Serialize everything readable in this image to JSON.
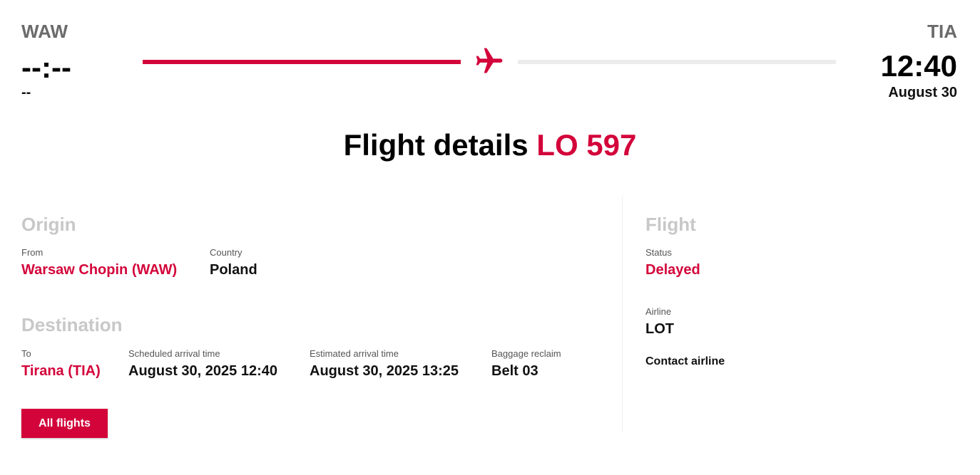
{
  "route": {
    "origin_code": "WAW",
    "destination_code": "TIA",
    "departure_time": "--:--",
    "departure_date": "--",
    "arrival_time": "12:40",
    "arrival_date": "August 30",
    "progress": 0.5
  },
  "title": {
    "prefix": "Flight details",
    "flight_number": "LO 597"
  },
  "origin": {
    "heading": "Origin",
    "from_label": "From",
    "from_value": "Warsaw Chopin (WAW)",
    "country_label": "Country",
    "country_value": "Poland"
  },
  "destination": {
    "heading": "Destination",
    "to_label": "To",
    "to_value": "Tirana (TIA)",
    "scheduled_label": "Scheduled arrival time",
    "scheduled_value": "August 30, 2025 12:40",
    "estimated_label": "Estimated arrival time",
    "estimated_value": "August 30, 2025 13:25",
    "baggage_label": "Baggage reclaim",
    "baggage_value": "Belt 03"
  },
  "flight": {
    "heading": "Flight",
    "status_label": "Status",
    "status_value": "Delayed",
    "airline_label": "Airline",
    "airline_value": "LOT",
    "contact_link": "Contact airline"
  },
  "actions": {
    "all_flights_button": "All flights"
  },
  "colors": {
    "accent": "#d3043a",
    "heading_muted": "#c8c8c8",
    "track_remaining": "#ececec"
  },
  "icons": {
    "plane": "plane-icon"
  }
}
